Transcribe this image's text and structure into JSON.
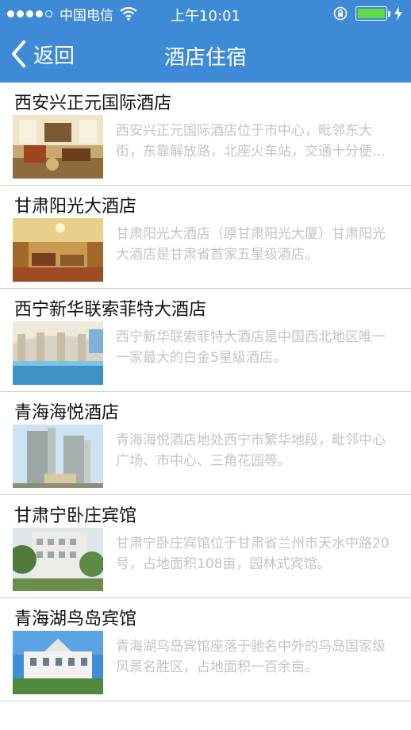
{
  "status_bar": {
    "carrier": "中国电信",
    "time": "上午10:01",
    "signal_icon": "signal-dots-icon",
    "wifi_icon": "wifi-icon",
    "lock_icon": "orientation-lock-icon",
    "battery_icon": "battery-icon",
    "charging_icon": "charging-bolt-icon"
  },
  "nav": {
    "back_label": "返回",
    "back_icon": "chevron-left-icon",
    "title": "酒店住宿"
  },
  "colors": {
    "header_bg": "#3f8ad6",
    "desc_text": "#c4c4c4",
    "battery_fill": "#5ddc3f"
  },
  "hotels": [
    {
      "name": "西安兴正元国际酒店",
      "desc": "西安兴正元国际酒店位于市中心，毗邻东大街，东靠解放路，北座火车站，交通十分便利。"
    },
    {
      "name": "甘肃阳光大酒店",
      "desc": "甘肃阳光大酒店（原甘肃阳光大厦）甘肃阳光大酒店是甘肃省首家五星级酒店。"
    },
    {
      "name": "西宁新华联索菲特大酒店",
      "desc": "西宁新华联索菲特大酒店是中国西北地区唯一一家最大的白金5星级酒店。"
    },
    {
      "name": "青海海悦酒店",
      "desc": "青海海悦酒店地处西宁市繁华地段，毗邻中心广场、市中心、三角花园等。"
    },
    {
      "name": "甘肃宁卧庄宾馆",
      "desc": "甘肃宁卧庄宾馆位于甘肃省兰州市天水中路20号，占地面积108亩，园林式宾馆。"
    },
    {
      "name": "青海湖鸟岛宾馆",
      "desc": "青海湖鸟岛宾馆座落于驰名中外的鸟岛国家级风景名胜区，占地面积一百余亩。"
    }
  ]
}
